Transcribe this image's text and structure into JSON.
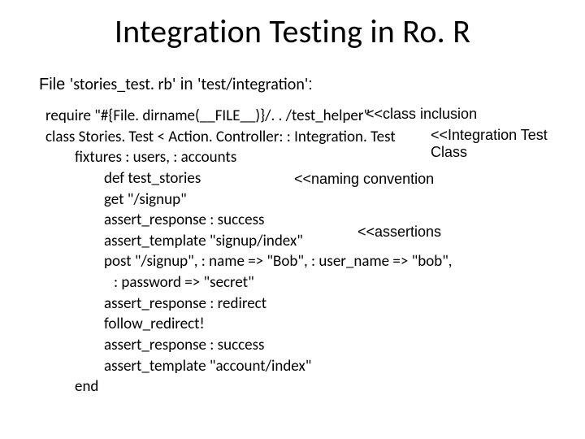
{
  "title": "Integration Testing in Ro. R",
  "file_line": {
    "prefix": "File ",
    "filename": "'stories_test. rb'",
    "mid": " in ",
    "dir": "'test/integration'",
    "suffix": ":"
  },
  "code": {
    "l1": "require \"#{File. dirname(__FILE__)}/. . /test_helper\"",
    "l2": "class Stories. Test < Action. Controller: : Integration. Test",
    "l3": "fixtures : users, : accounts",
    "l4": "def test_stories",
    "l5": "get \"/signup\"",
    "l6": "assert_response : success",
    "l7": "assert_template \"signup/index\"",
    "l8": "post \"/signup\", : name => \"Bob\", : user_name => \"bob\",",
    "l9": " : password => \"secret\"",
    "l10": "assert_response : redirect",
    "l11": "follow_redirect!",
    "l12": "assert_response : success",
    "l13": "assert_template \"account/index\"",
    "l14": "end"
  },
  "annotations": {
    "class_inclusion": "<<class inclusion",
    "integration_class": "<<Integration Test Class",
    "naming_convention": "<<naming convention",
    "assertions": "<<assertions"
  }
}
